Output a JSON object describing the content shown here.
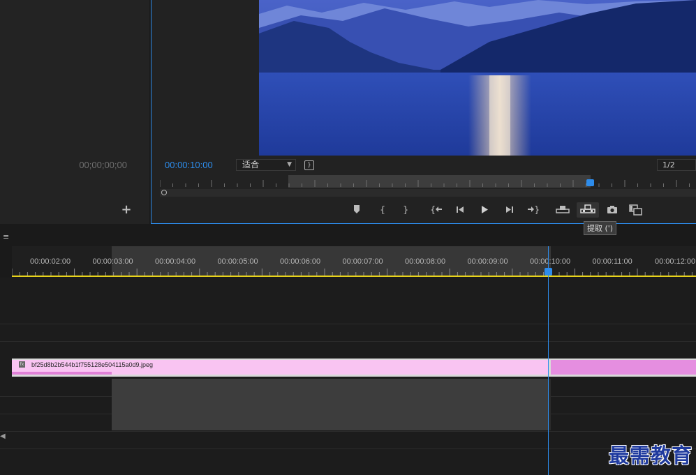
{
  "source_monitor": {
    "timecode": "00;00;00;00",
    "add_icon": "plus-icon"
  },
  "program_monitor": {
    "timecode": "00:00:10:00",
    "fit_select": "适合",
    "resolution_select": "1/2",
    "transport_buttons": [
      {
        "name": "add-marker",
        "icon": "marker-icon"
      },
      {
        "name": "mark-in",
        "icon": "mark-in-icon"
      },
      {
        "name": "mark-out",
        "icon": "mark-out-icon"
      },
      {
        "name": "go-to-in",
        "icon": "go-to-in-icon"
      },
      {
        "name": "step-back",
        "icon": "step-back-icon"
      },
      {
        "name": "play",
        "icon": "play-icon"
      },
      {
        "name": "step-forward",
        "icon": "step-forward-icon"
      },
      {
        "name": "go-to-out",
        "icon": "go-to-out-icon"
      },
      {
        "name": "lift",
        "icon": "lift-icon"
      },
      {
        "name": "extract",
        "icon": "extract-icon"
      },
      {
        "name": "export-frame",
        "icon": "camera-icon"
      },
      {
        "name": "compare-view",
        "icon": "compare-icon"
      }
    ],
    "tooltip": "提取 (')"
  },
  "timeline": {
    "menu_icon": "≡",
    "tick_labels": [
      "00:00:02:00",
      "00:00:03:00",
      "00:00:04:00",
      "00:00:05:00",
      "00:00:06:00",
      "00:00:07:00",
      "00:00:08:00",
      "00:00:09:00",
      "00:00:10:00",
      "00:00:11:00",
      "00:00:12:00"
    ],
    "clip_name": "bf25d8b2b544b1f755128e504115a0d9.jpeg",
    "clip_fx_badge": "fx",
    "playhead_time": "00:00:10:00"
  },
  "watermark": "最需教育",
  "colors": {
    "accent": "#2d8ceb",
    "clip_pink": "#f9c4f2",
    "clip_pink_dark": "#e58ee0",
    "work_area": "#e8d31b"
  }
}
